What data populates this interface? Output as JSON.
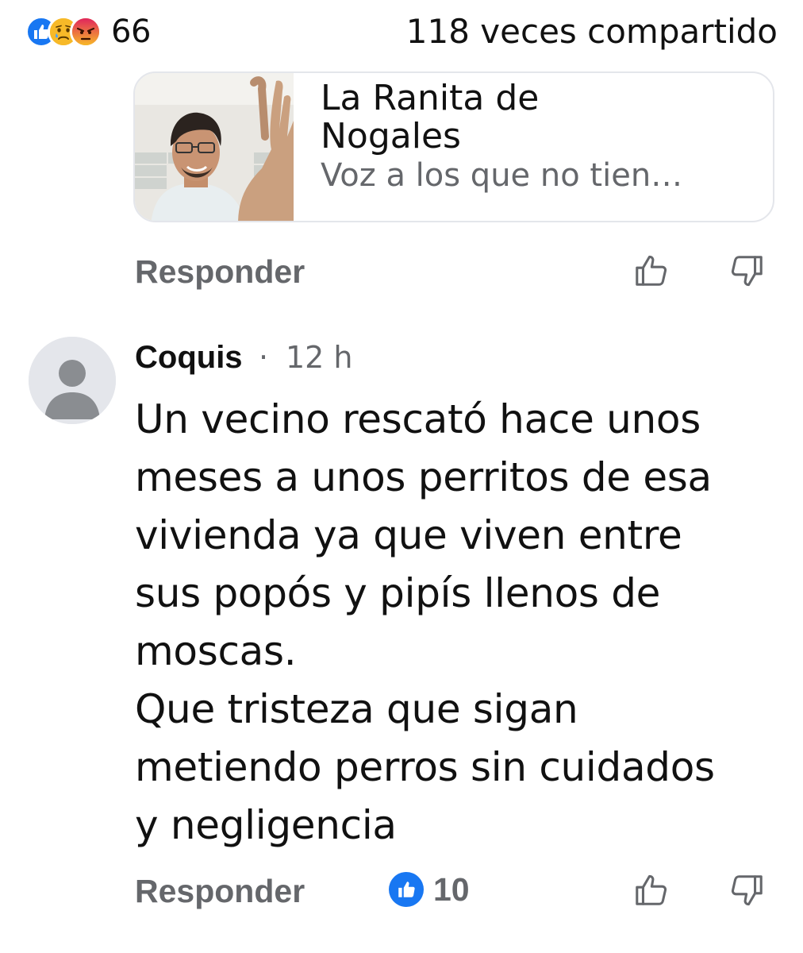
{
  "post": {
    "reaction_icons": [
      "like-icon",
      "sad-icon",
      "angry-icon"
    ],
    "reaction_count": "66",
    "shares_text": "118 veces compartido"
  },
  "link_card": {
    "title": "La Ranita de Nogales",
    "subtitle": "Voz a los que no tien…",
    "thumbnail": "man-waving-photo"
  },
  "previous_comment_actions": {
    "reply_label": "Responder",
    "icons": [
      "thumbs-up-outline-icon",
      "thumbs-down-outline-icon"
    ]
  },
  "comment": {
    "author": "Coquis",
    "separator": "·",
    "time": "12 h",
    "avatar": "default-avatar-icon",
    "text": "Un vecino rescató hace unos\nmeses a unos perritos de esa\nvivienda ya que viven entre\nsus popós y pipís llenos de\nmoscas.\nQue tristeza que sigan\nmetiendo perros sin cuidados\ny negligencia",
    "reply_label": "Responder",
    "like_icon": "like-icon",
    "like_count": "10"
  },
  "colors": {
    "facebook_blue": "#1877f2",
    "secondary_text": "#65676b",
    "card_border": "#e4e6eb"
  }
}
